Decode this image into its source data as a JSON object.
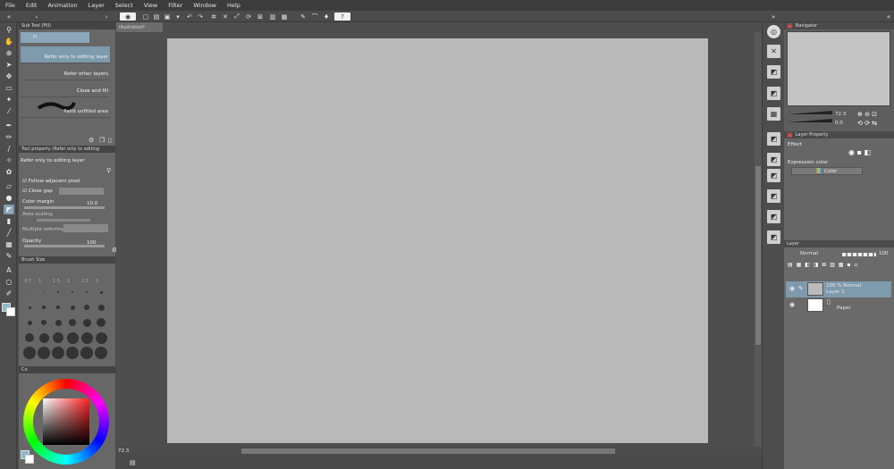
{
  "menu": [
    "File",
    "Edit",
    "Animation",
    "Layer",
    "Select",
    "View",
    "Filter",
    "Window",
    "Help"
  ],
  "subtool": {
    "title": "Sub Tool (Fill)",
    "field": "Fi",
    "items": [
      {
        "label": "Refer only to editing layer",
        "selected": true
      },
      {
        "label": "Refer other layers",
        "selected": false
      },
      {
        "label": "Close and fill",
        "selected": false
      },
      {
        "label": "Paint unfilled area",
        "selected": false
      }
    ]
  },
  "toolprop": {
    "title": "Tool property (Refer only to editing",
    "subtitle": "Refer only to editing layer",
    "follow": "Follow adjacent pixel",
    "close_gap": "Close gap",
    "color_margin": "Color margin",
    "color_margin_value": "10.0",
    "area_scaling": "Area scaling",
    "multiple": "Multiple referring",
    "opacity": "Opacity",
    "opacity_value": "100"
  },
  "brush": {
    "title": "Brush Size",
    "sizes": [
      "0.7",
      "1",
      "1.5",
      "2",
      "2.5",
      "3"
    ]
  },
  "color": {
    "title": "Co",
    "fg": "#8fb8c8"
  },
  "document": {
    "tab": "Illustration*",
    "zoom": "72.3"
  },
  "navigator": {
    "title": "Navigator",
    "zoom": "72.3",
    "angle": "0.0"
  },
  "layer_property": {
    "title": "Layer Property",
    "effect": "Effect",
    "expression_label": "Expression color",
    "expression_value": "Color"
  },
  "layer": {
    "title": "Layer",
    "blend": "Normal",
    "opacity": "100",
    "layers": [
      {
        "line1": "100 % Normal",
        "line2": "Layer 1",
        "selected": true
      },
      {
        "line1": "",
        "line2": "Paper",
        "selected": false
      }
    ]
  }
}
